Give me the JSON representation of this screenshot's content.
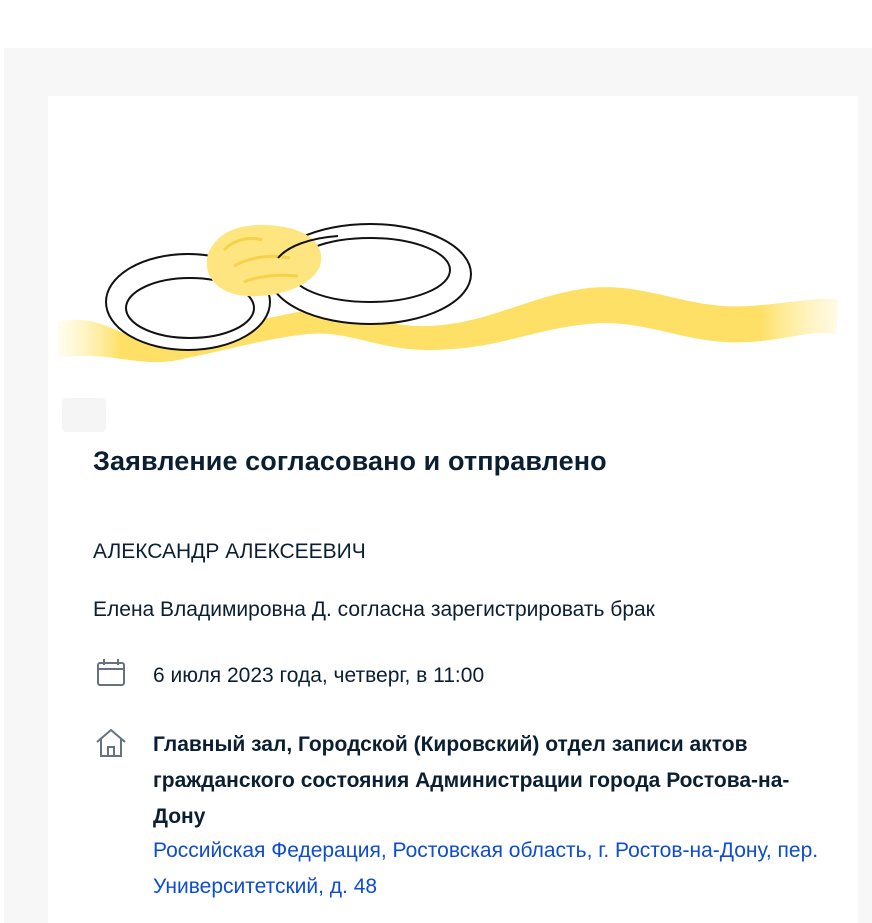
{
  "status": {
    "title": "Заявление согласовано и отправлено"
  },
  "applicant": {
    "name": "АЛЕКСАНДР АЛЕКСЕЕВИЧ",
    "consent_text": "Елена Владимировна Д. согласна зарегистрировать брак"
  },
  "ceremony": {
    "date_text": "6 июля 2023 года, четверг, в 11:00",
    "place_name": "Главный зал, Городской (Кировский) отдел записи актов гражданского состояния Администрации города Ростова-на-Дону",
    "place_address": "Российская Федерация, Ростовская область, г. Ростов-на-Дону, пер. Университетский, д. 48"
  },
  "icons": {
    "illustration": "wedding-rings-ribbon",
    "date": "calendar-icon",
    "place": "home-icon"
  },
  "colors": {
    "ribbon": "#ffe066",
    "link": "#0d4cd3",
    "text": "#0b1f33",
    "icon": "#66727f"
  }
}
